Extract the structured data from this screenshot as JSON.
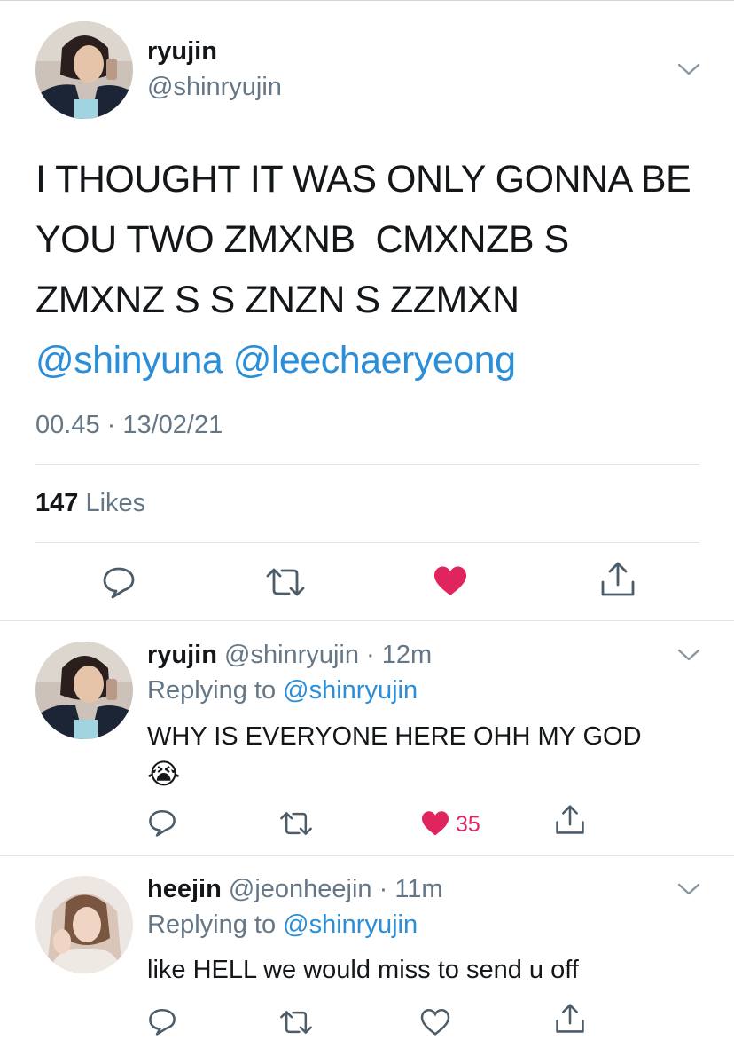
{
  "main_tweet": {
    "display_name": "ryujin",
    "handle": "@shinryujin",
    "text_lines": [
      "I THOUGHT IT WAS ONLY GONNA BE",
      "YOU TWO ZMXNB  CMXNZB S",
      "ZMXNZ S S ZNZN S ZZMXN"
    ],
    "mentions": "@shinyuna @leechaeryeong",
    "timestamp": "00.45 · 13/02/21",
    "likes_count": "147",
    "likes_label": "Likes"
  },
  "replies": [
    {
      "display_name": "ryujin",
      "handle": "@shinryujin",
      "time": "· 12m",
      "replying_label": "Replying to",
      "replying_to": "@shinryujin",
      "text": "WHY IS EVERYONE HERE OHH MY GOD",
      "emoji": "😭",
      "like_count": "35",
      "liked": true
    },
    {
      "display_name": "heejin",
      "handle": "@jeonheejin",
      "time": "· 11m",
      "replying_label": "Replying to",
      "replying_to": "@shinryujin",
      "text": "like HELL we would miss to send u off",
      "liked": false
    }
  ],
  "colors": {
    "like_red": "#e0245e",
    "link_blue": "#2b8ed8",
    "muted_grey": "#657786",
    "divider": "#e1e6ea"
  },
  "icons": [
    "reply-icon",
    "retweet-icon",
    "heart-icon",
    "share-icon",
    "chevron-down-icon"
  ]
}
